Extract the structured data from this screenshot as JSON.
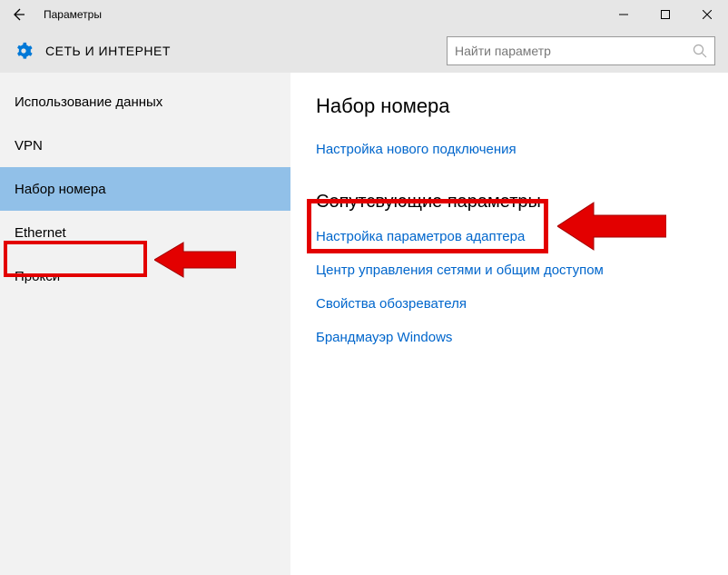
{
  "window": {
    "title": "Параметры"
  },
  "header": {
    "section_title": "СЕТЬ И ИНТЕРНЕТ",
    "search_placeholder": "Найти параметр"
  },
  "sidebar": {
    "items": [
      {
        "label": "Использование данных",
        "selected": false
      },
      {
        "label": "VPN",
        "selected": false
      },
      {
        "label": "Набор номера",
        "selected": true
      },
      {
        "label": "Ethernet",
        "selected": false
      },
      {
        "label": "Прокси",
        "selected": false
      }
    ]
  },
  "main": {
    "heading": "Набор номера",
    "primary_link": "Настройка нового подключения",
    "related_heading": "Сопутсвующие параметры",
    "related_links": [
      "Настройка параметров адаптера",
      "Центр управления сетями и общим доступом",
      "Свойства обозревателя",
      "Брандмауэр Windows"
    ]
  }
}
